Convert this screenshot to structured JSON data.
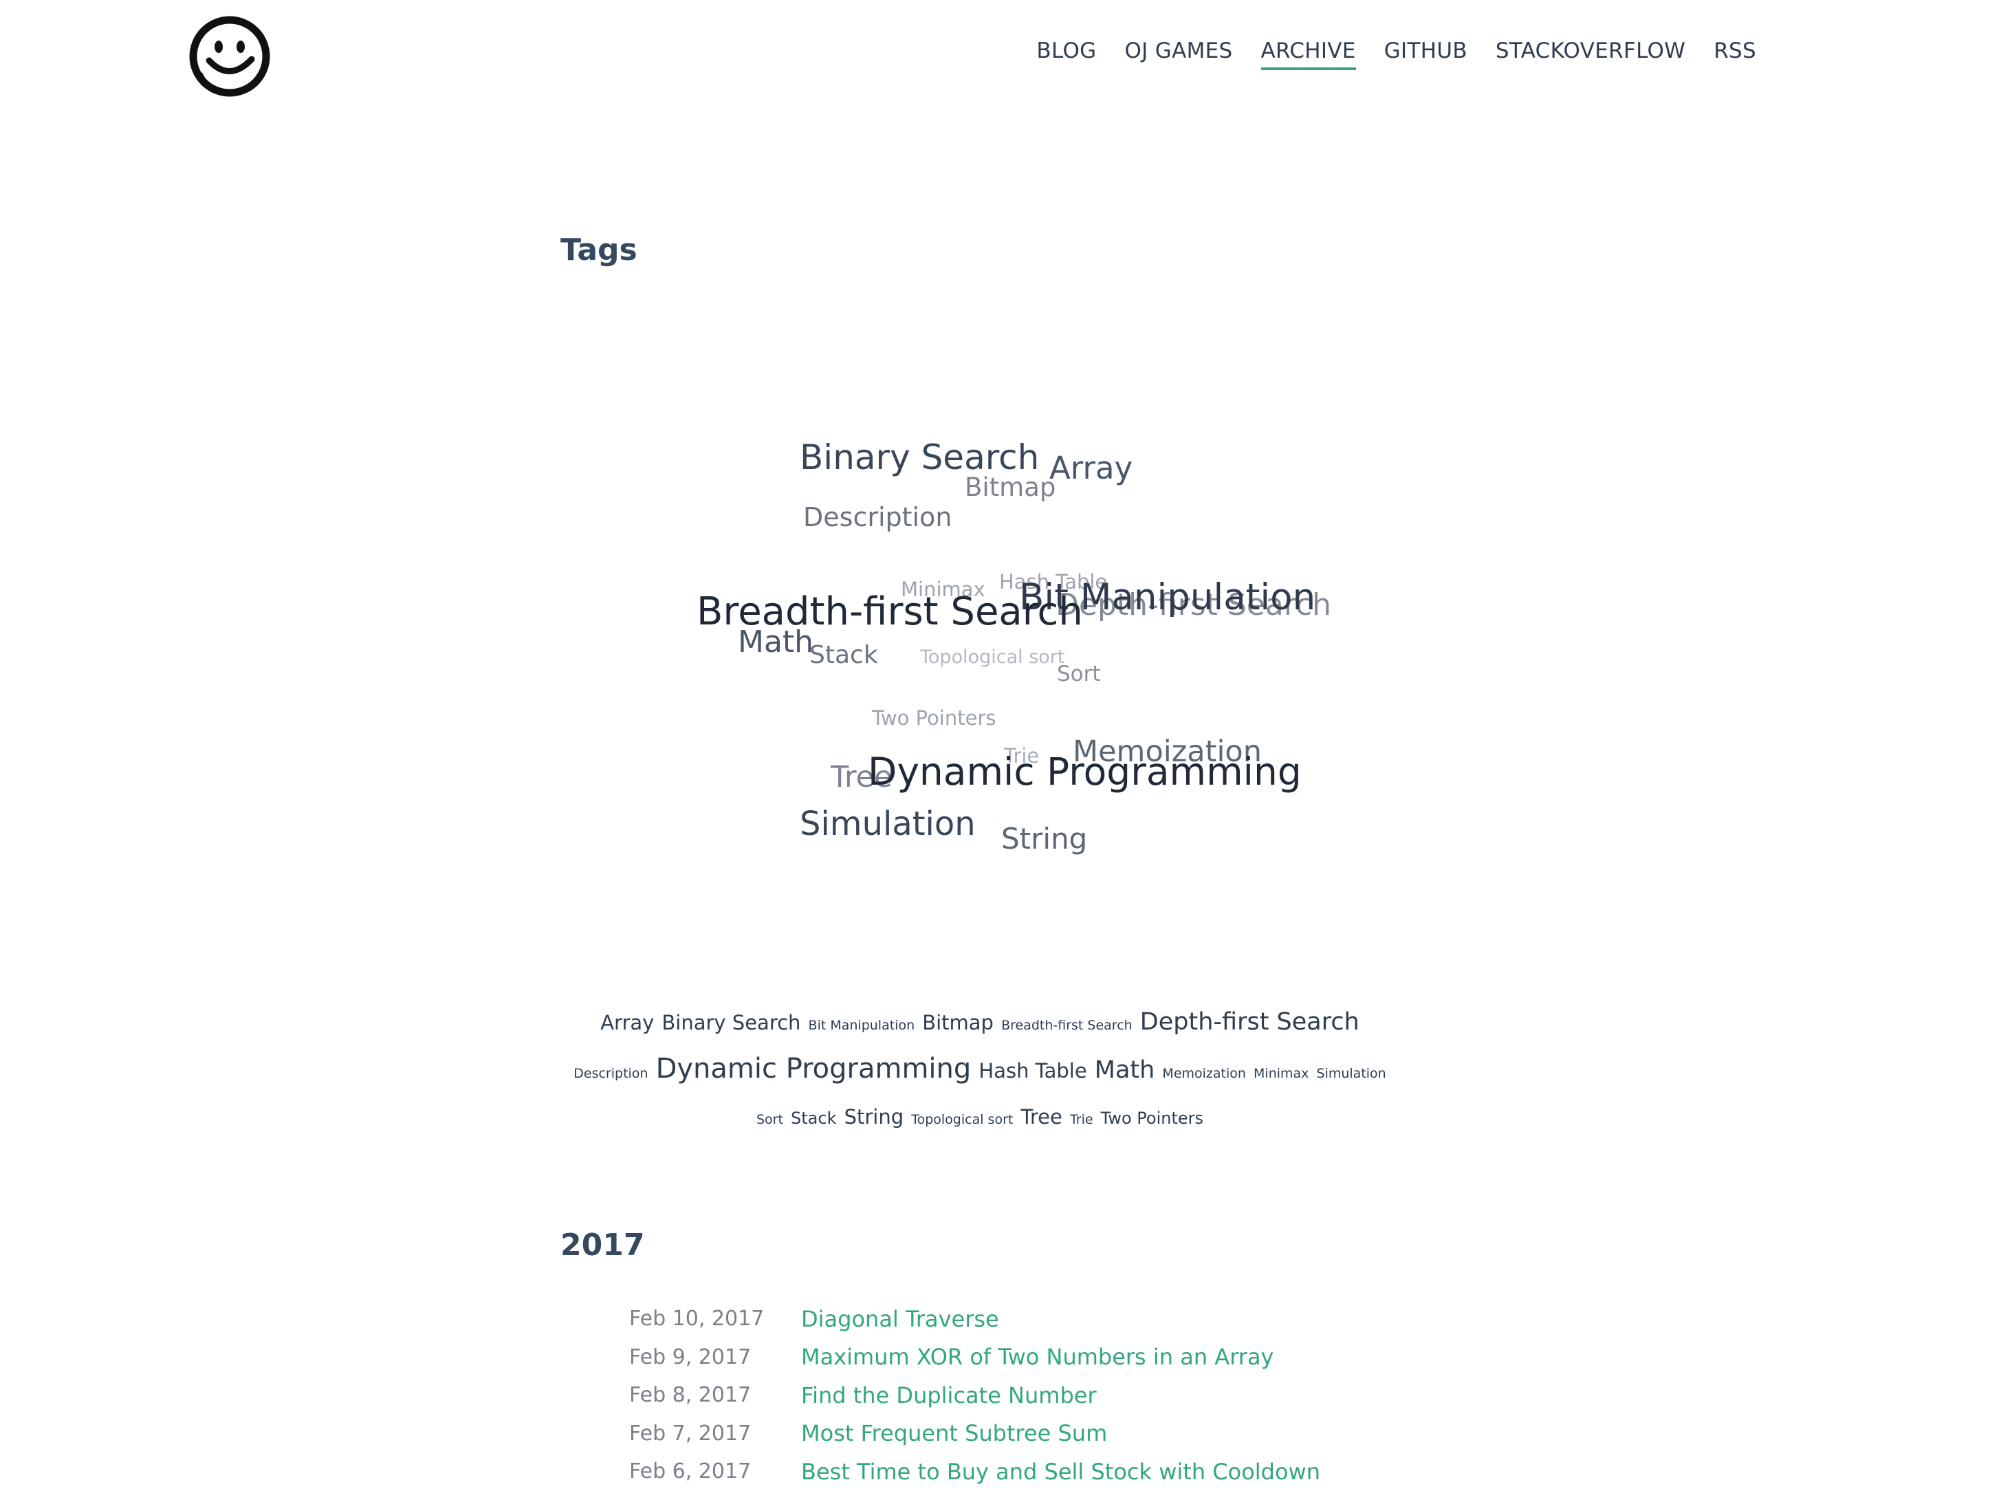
{
  "nav": {
    "items": [
      {
        "label": "BLOG",
        "name": "nav-blog",
        "active": false
      },
      {
        "label": "OJ GAMES",
        "name": "nav-oj-games",
        "active": false
      },
      {
        "label": "ARCHIVE",
        "name": "nav-archive",
        "active": true
      },
      {
        "label": "GITHUB",
        "name": "nav-github",
        "active": false
      },
      {
        "label": "STACKOVERFLOW",
        "name": "nav-stackoverflow",
        "active": false
      },
      {
        "label": "RSS",
        "name": "nav-rss",
        "active": false
      }
    ]
  },
  "tags_section": {
    "title": "Tags"
  },
  "tag_cloud": [
    {
      "text": "Binary Search",
      "weight": 4,
      "color": "#39465a"
    },
    {
      "text": "Array",
      "weight": 3,
      "color": "#4a5568"
    },
    {
      "text": "Bitmap",
      "weight": 2,
      "color": "#7c8290"
    },
    {
      "text": "Description",
      "weight": 2,
      "color": "#6b7280"
    },
    {
      "text": "Minimax",
      "weight": 1,
      "color": "#9ea3ad"
    },
    {
      "text": "Hash Table",
      "weight": 1,
      "color": "#9ea3ad"
    },
    {
      "text": "Depth-first Search",
      "weight": 3,
      "color": "#858a96"
    },
    {
      "text": "Bit Manipulation",
      "weight": 5,
      "color": "#2f3a4c"
    },
    {
      "text": "Breadth-first Search",
      "weight": 5,
      "color": "#1f2937"
    },
    {
      "text": "Math",
      "weight": 3,
      "color": "#4a5568"
    },
    {
      "text": "Stack",
      "weight": 2,
      "color": "#6b7280"
    },
    {
      "text": "Topological sort",
      "weight": 1,
      "color": "#b4b8c0"
    },
    {
      "text": "Sort",
      "weight": 2,
      "color": "#8b909a"
    },
    {
      "text": "Two Pointers",
      "weight": 1,
      "color": "#9ea3ad"
    },
    {
      "text": "Memoization",
      "weight": 3,
      "color": "#5d6675"
    },
    {
      "text": "Trie",
      "weight": 1,
      "color": "#a7acb5"
    },
    {
      "text": "Tree",
      "weight": 2,
      "color": "#7c8290"
    },
    {
      "text": "Dynamic Programming",
      "weight": 5,
      "color": "#1f2937"
    },
    {
      "text": "Simulation",
      "weight": 4,
      "color": "#39465a"
    },
    {
      "text": "String",
      "weight": 3,
      "color": "#5d6675"
    }
  ],
  "tag_list": [
    {
      "text": "Array",
      "size": 3
    },
    {
      "text": "Binary Search",
      "size": 3
    },
    {
      "text": "Bit Manipulation",
      "size": 1
    },
    {
      "text": "Bitmap",
      "size": 3
    },
    {
      "text": "Breadth-first Search",
      "size": 1
    },
    {
      "text": "Depth-first Search",
      "size": 4
    },
    {
      "text": "Description",
      "size": 1
    },
    {
      "text": "Dynamic Programming",
      "size": 5
    },
    {
      "text": "Hash Table",
      "size": 3
    },
    {
      "text": "Math",
      "size": 4
    },
    {
      "text": "Memoization",
      "size": 1
    },
    {
      "text": "Minimax",
      "size": 1
    },
    {
      "text": "Simulation",
      "size": 1
    },
    {
      "text": "Sort",
      "size": 1
    },
    {
      "text": "Stack",
      "size": 2
    },
    {
      "text": "String",
      "size": 3
    },
    {
      "text": "Topological sort",
      "size": 1
    },
    {
      "text": "Tree",
      "size": 3
    },
    {
      "text": "Trie",
      "size": 1
    },
    {
      "text": "Two Pointers",
      "size": 2
    }
  ],
  "year_section": {
    "title": "2017"
  },
  "posts": [
    {
      "date": "Feb 10, 2017",
      "title": "Diagonal Traverse"
    },
    {
      "date": "Feb 9, 2017",
      "title": "Maximum XOR of Two Numbers in an Array"
    },
    {
      "date": "Feb 8, 2017",
      "title": "Find the Duplicate Number"
    },
    {
      "date": "Feb 7, 2017",
      "title": "Most Frequent Subtree Sum"
    },
    {
      "date": "Feb 6, 2017",
      "title": "Best Time to Buy and Sell Stock with Cooldown"
    }
  ]
}
